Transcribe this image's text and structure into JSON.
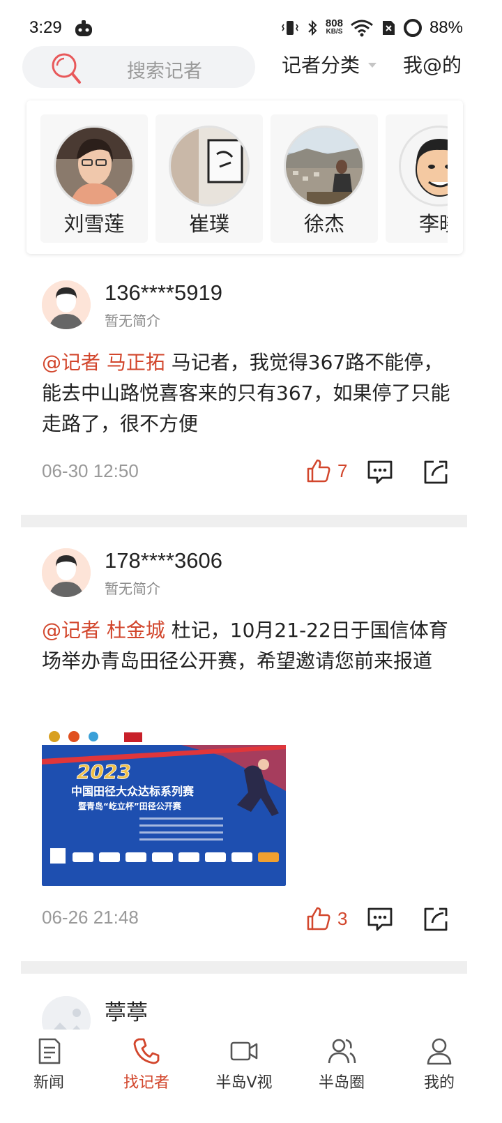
{
  "status_bar": {
    "time": "3:29",
    "net_speed_value": "808",
    "net_speed_unit": "KB/S",
    "battery": "88%"
  },
  "header": {
    "search_placeholder": "搜索记者",
    "category_label": "记者分类",
    "my_at_label": "我@的"
  },
  "reporters": [
    {
      "name": "刘雪莲"
    },
    {
      "name": "崔璞"
    },
    {
      "name": "徐杰"
    },
    {
      "name": "李晓"
    }
  ],
  "posts": [
    {
      "user": "136****5919",
      "bio": "暂无简介",
      "mention": "@记者 马正拓",
      "text": " 马记者，我觉得367路不能停，能去中山路悦喜客来的只有367，如果停了只能走路了，很不方便",
      "time": "06-30 12:50",
      "likes": "7"
    },
    {
      "user": "178****3606",
      "bio": "暂无简介",
      "mention": "@记者 杜金城",
      "text": " 杜记，10月21-22日于国信体育场举办青岛田径公开赛，希望邀请您前来报道",
      "time": "06-26 21:48",
      "likes": "3",
      "image": {
        "year": "2023",
        "line1": "中国田径大众达标系列赛",
        "line2": "暨青岛“屹立杯”田径公开赛"
      }
    },
    {
      "user": "葶葶"
    }
  ],
  "bottom_nav": [
    {
      "label": "新闻",
      "icon": "news-icon"
    },
    {
      "label": "找记者",
      "icon": "phone-icon"
    },
    {
      "label": "半岛V视",
      "icon": "video-icon"
    },
    {
      "label": "半岛圈",
      "icon": "community-icon"
    },
    {
      "label": "我的",
      "icon": "profile-icon"
    }
  ],
  "colors": {
    "accent": "#d2462c",
    "separator": "#efefef",
    "search_bg": "#f2f3f5"
  }
}
